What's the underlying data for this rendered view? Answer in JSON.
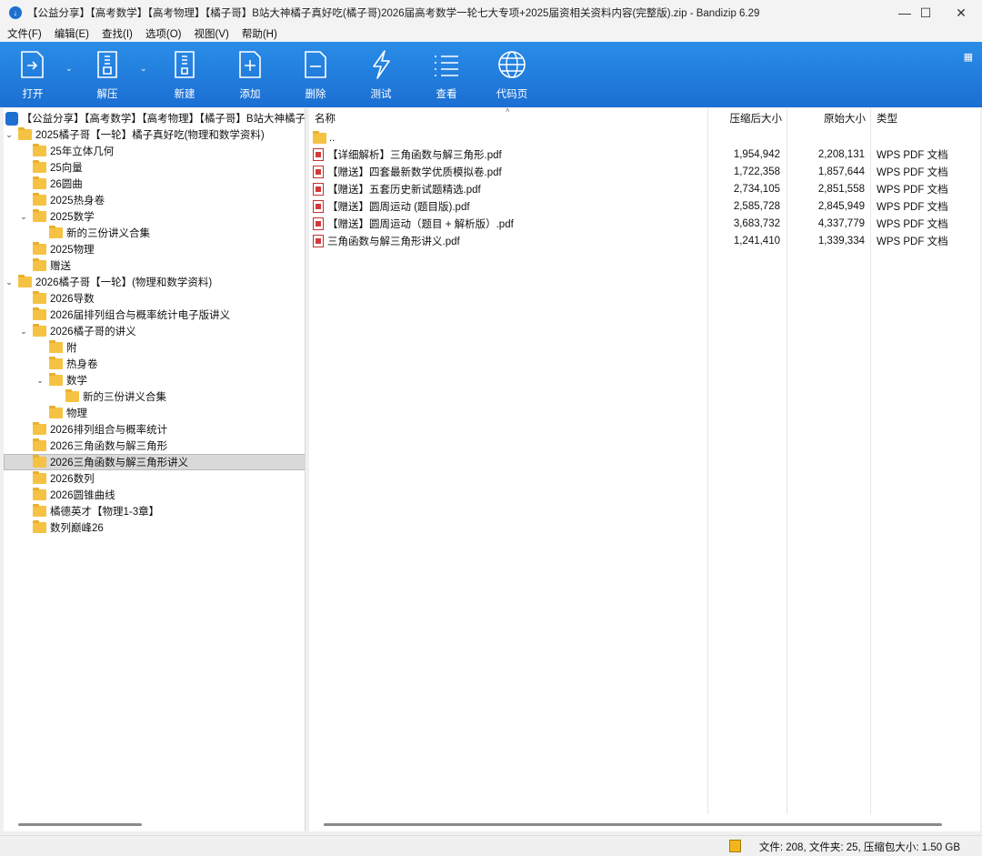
{
  "window": {
    "title": "【公益分享】【高考数学】【高考物理】【橘子哥】B站大神橘子真好吃(橘子哥)2026届高考数学一轮七大专项+2025届资相关资料内容(完整版).zip - Bandizip 6.29",
    "app_icon": "bandizip-icon",
    "controls": {
      "minimize": "—",
      "maximize": "☐",
      "close": "✕"
    }
  },
  "menu": [
    "文件(F)",
    "编辑(E)",
    "查找(I)",
    "选项(O)",
    "视图(V)",
    "帮助(H)"
  ],
  "toolbar": {
    "buttons": [
      {
        "label": "打开",
        "icon": "open-icon"
      },
      {
        "label": "解压",
        "icon": "extract-icon"
      },
      {
        "label": "新建",
        "icon": "new-archive-icon"
      },
      {
        "label": "添加",
        "icon": "add-file-icon"
      },
      {
        "label": "删除",
        "icon": "delete-file-icon"
      },
      {
        "label": "测试",
        "icon": "test-icon"
      },
      {
        "label": "查看",
        "icon": "view-list-icon"
      },
      {
        "label": "代码页",
        "icon": "codepage-globe-icon"
      }
    ],
    "dropdown_glyph": "⌄",
    "layout_glyph": "▦"
  },
  "tree": {
    "root": "【公益分享】【高考数学】【高考物理】【橘子哥】B站大神橘子",
    "items": [
      {
        "label": "2025橘子哥【一轮】橘子真好吃(物理和数学资料)",
        "level": 0,
        "expanded": true
      },
      {
        "label": "25年立体几何",
        "level": 1
      },
      {
        "label": "25向量",
        "level": 1
      },
      {
        "label": "26圆曲",
        "level": 1
      },
      {
        "label": "2025热身卷",
        "level": 1
      },
      {
        "label": "2025数学",
        "level": 1,
        "expanded": true
      },
      {
        "label": "新的三份讲义合集",
        "level": 2
      },
      {
        "label": "2025物理",
        "level": 1
      },
      {
        "label": "赠送",
        "level": 1
      },
      {
        "label": "2026橘子哥【一轮】(物理和数学资料)",
        "level": 0,
        "expanded": true
      },
      {
        "label": "2026导数",
        "level": 1
      },
      {
        "label": "2026届排列组合与概率统计电子版讲义",
        "level": 1
      },
      {
        "label": "2026橘子哥的讲义",
        "level": 1,
        "expanded": true
      },
      {
        "label": "附",
        "level": 2
      },
      {
        "label": "热身卷",
        "level": 2
      },
      {
        "label": "数学",
        "level": 2,
        "expanded": true
      },
      {
        "label": "新的三份讲义合集",
        "level": 3
      },
      {
        "label": "物理",
        "level": 2
      },
      {
        "label": "2026排列组合与概率统计",
        "level": 1
      },
      {
        "label": "2026三角函数与解三角形",
        "level": 1
      },
      {
        "label": "2026三角函数与解三角形讲义",
        "level": 1,
        "selected": true
      },
      {
        "label": "2026数列",
        "level": 1
      },
      {
        "label": "2026圆锥曲线",
        "level": 1
      },
      {
        "label": "橘德英才【物理1-3章】",
        "level": 1
      },
      {
        "label": "数列巅峰26",
        "level": 1
      }
    ],
    "expand_glyph": "⌄"
  },
  "list": {
    "columns": {
      "name": "名称",
      "packed": "压缩后大小",
      "original": "原始大小",
      "type": "类型"
    },
    "sort_glyph": "˄",
    "parent": "..",
    "files": [
      {
        "name": "【详细解析】三角函数与解三角形.pdf",
        "packed": "1,954,942",
        "original": "2,208,131",
        "type": "WPS PDF 文档"
      },
      {
        "name": "【赠送】四套最新数学优质模拟卷.pdf",
        "packed": "1,722,358",
        "original": "1,857,644",
        "type": "WPS PDF 文档"
      },
      {
        "name": "【赠送】五套历史新试题精选.pdf",
        "packed": "2,734,105",
        "original": "2,851,558",
        "type": "WPS PDF 文档"
      },
      {
        "name": "【赠送】圆周运动 (题目版).pdf",
        "packed": "2,585,728",
        "original": "2,845,949",
        "type": "WPS PDF 文档"
      },
      {
        "name": "【赠送】圆周运动（题目 + 解析版）.pdf",
        "packed": "3,683,732",
        "original": "4,337,779",
        "type": "WPS PDF 文档"
      },
      {
        "name": "三角函数与解三角形讲义.pdf",
        "packed": "1,241,410",
        "original": "1,339,334",
        "type": "WPS PDF 文档"
      }
    ]
  },
  "status": {
    "text": "文件: 208, 文件夹: 25, 压缩包大小: 1.50 GB"
  }
}
